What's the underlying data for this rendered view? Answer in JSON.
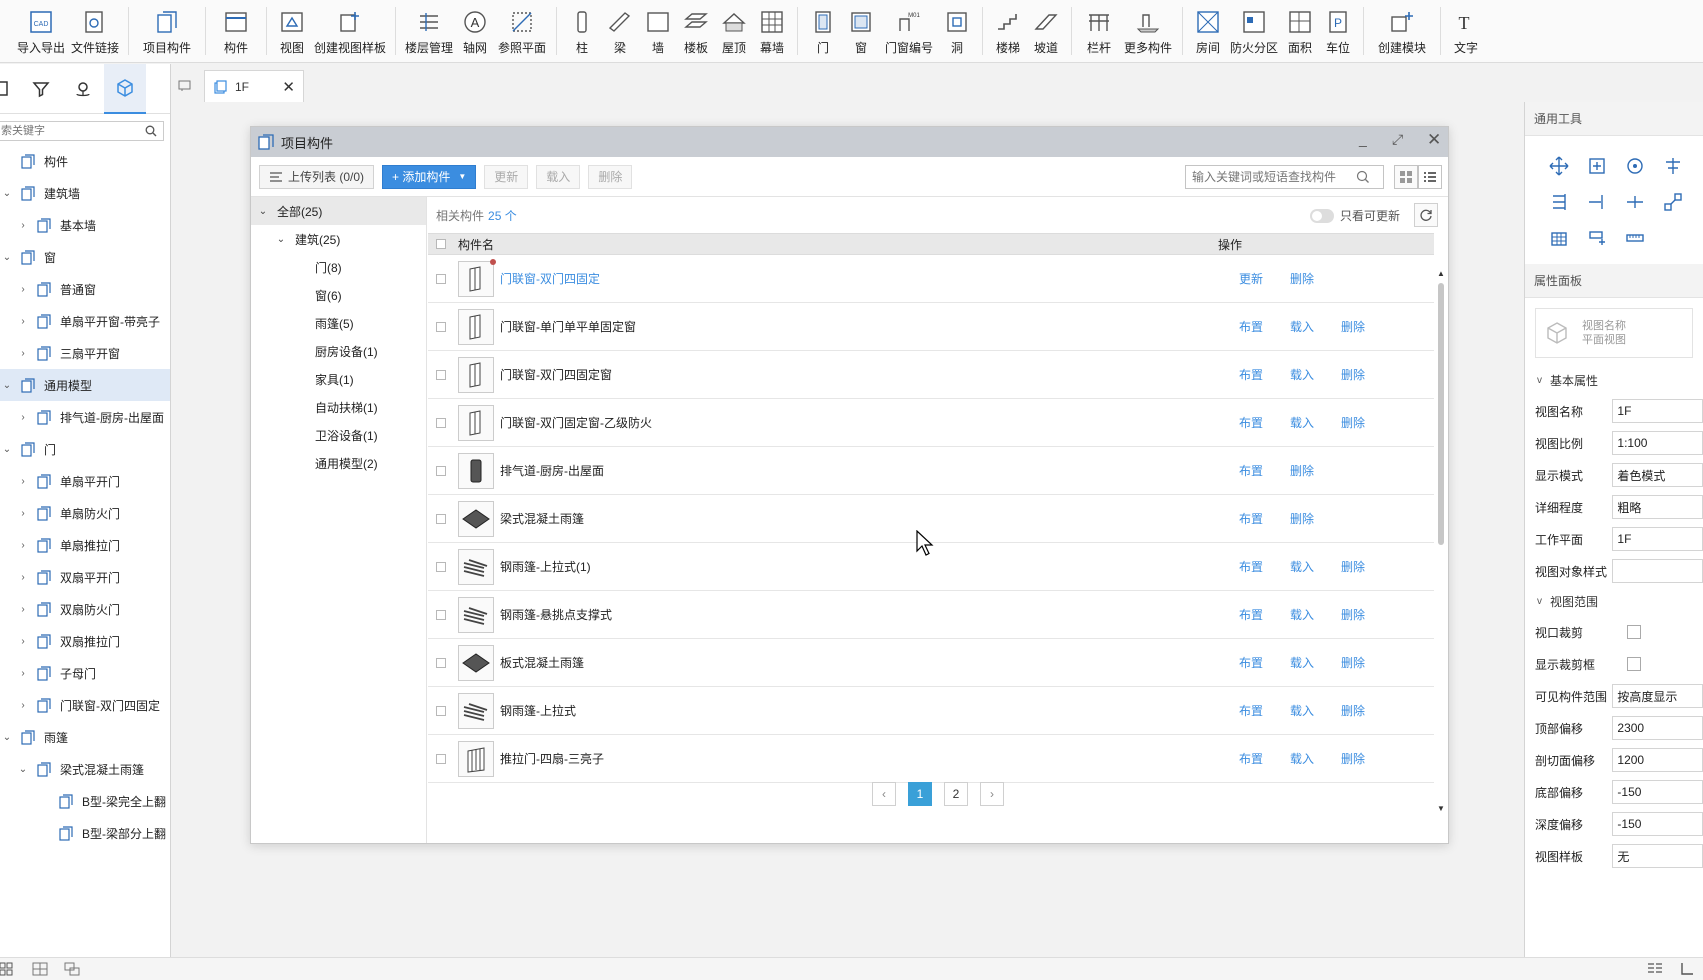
{
  "toolbar": {
    "items": [
      {
        "label": "导入导出",
        "icon": "cad-import-icon"
      },
      {
        "label": "文件链接",
        "icon": "file-link-icon"
      },
      {
        "label": "项目构件",
        "icon": "project-component-icon"
      },
      {
        "label": "构件",
        "icon": "component-icon"
      },
      {
        "label": "视图",
        "icon": "view-icon"
      },
      {
        "label": "创建视图样板",
        "icon": "view-template-icon"
      },
      {
        "label": "楼层管理",
        "icon": "floor-manage-icon"
      },
      {
        "label": "轴网",
        "icon": "axis-grid-icon"
      },
      {
        "label": "参照平面",
        "icon": "reference-plane-icon"
      },
      {
        "label": "柱",
        "icon": "column-icon"
      },
      {
        "label": "梁",
        "icon": "beam-icon"
      },
      {
        "label": "墙",
        "icon": "wall-icon"
      },
      {
        "label": "楼板",
        "icon": "slab-icon"
      },
      {
        "label": "屋顶",
        "icon": "roof-icon"
      },
      {
        "label": "幕墙",
        "icon": "curtain-wall-icon"
      },
      {
        "label": "门",
        "icon": "door-icon"
      },
      {
        "label": "窗",
        "icon": "window-icon"
      },
      {
        "label": "门窗编号",
        "icon": "door-window-number-icon"
      },
      {
        "label": "洞",
        "icon": "opening-icon"
      },
      {
        "label": "楼梯",
        "icon": "stair-icon"
      },
      {
        "label": "坡道",
        "icon": "ramp-icon"
      },
      {
        "label": "栏杆",
        "icon": "railing-icon"
      },
      {
        "label": "更多构件",
        "icon": "more-components-icon"
      },
      {
        "label": "房间",
        "icon": "room-icon"
      },
      {
        "label": "防火分区",
        "icon": "fire-zone-icon"
      },
      {
        "label": "面积",
        "icon": "area-icon"
      },
      {
        "label": "车位",
        "icon": "parking-icon"
      },
      {
        "label": "创建模块",
        "icon": "create-module-icon"
      },
      {
        "label": "文字",
        "icon": "text-icon"
      }
    ]
  },
  "left_panel": {
    "search_placeholder": "索关键字",
    "tree": [
      {
        "label": "构件",
        "level": 0,
        "toggle": ""
      },
      {
        "label": "建筑墙",
        "level": 1,
        "toggle": "v"
      },
      {
        "label": "基本墙",
        "level": 2,
        "toggle": ">"
      },
      {
        "label": "窗",
        "level": 1,
        "toggle": "v"
      },
      {
        "label": "普通窗",
        "level": 2,
        "toggle": ">"
      },
      {
        "label": "单扇平开窗-带亮子",
        "level": 2,
        "toggle": ">"
      },
      {
        "label": "三扇平开窗",
        "level": 2,
        "toggle": ">"
      },
      {
        "label": "通用模型",
        "level": 1,
        "toggle": "v",
        "selected": true
      },
      {
        "label": "排气道-厨房-出屋面",
        "level": 2,
        "toggle": ">"
      },
      {
        "label": "门",
        "level": 1,
        "toggle": "v"
      },
      {
        "label": "单扇平开门",
        "level": 2,
        "toggle": ">"
      },
      {
        "label": "单扇防火门",
        "level": 2,
        "toggle": ">"
      },
      {
        "label": "单扇推拉门",
        "level": 2,
        "toggle": ">"
      },
      {
        "label": "双扇平开门",
        "level": 2,
        "toggle": ">"
      },
      {
        "label": "双扇防火门",
        "level": 2,
        "toggle": ">"
      },
      {
        "label": "双扇推拉门",
        "level": 2,
        "toggle": ">"
      },
      {
        "label": "子母门",
        "level": 2,
        "toggle": ">"
      },
      {
        "label": "门联窗-双门四固定",
        "level": 2,
        "toggle": ">"
      },
      {
        "label": "雨篷",
        "level": 1,
        "toggle": "v"
      },
      {
        "label": "梁式混凝土雨篷",
        "level": 2,
        "toggle": "v"
      },
      {
        "label": "B型-梁完全上翻",
        "level": 3,
        "toggle": ""
      },
      {
        "label": "B型-梁部分上翻",
        "level": 3,
        "toggle": ""
      }
    ]
  },
  "view_tab": {
    "label": "1F"
  },
  "dialog": {
    "title": "项目构件",
    "upload_label": "上传列表 (0/0)",
    "add_label": "+ 添加构件",
    "update_label": "更新",
    "load_label": "载入",
    "delete_label": "删除",
    "search_placeholder": "输入关键词或短语查找构件",
    "summary_label": "相关构件",
    "summary_count": "25 个",
    "toggle_label": "只看可更新",
    "col_name": "构件名",
    "col_ops": "操作",
    "categories": [
      {
        "label": "全部(25)",
        "indent": 0,
        "chev": "v",
        "selected": true
      },
      {
        "label": "建筑(25)",
        "indent": 1,
        "chev": "v"
      },
      {
        "label": "门(8)",
        "indent": 2,
        "chev": ""
      },
      {
        "label": "窗(6)",
        "indent": 2,
        "chev": ""
      },
      {
        "label": "雨篷(5)",
        "indent": 2,
        "chev": ""
      },
      {
        "label": "厨房设备(1)",
        "indent": 2,
        "chev": ""
      },
      {
        "label": "家具(1)",
        "indent": 2,
        "chev": ""
      },
      {
        "label": "自动扶梯(1)",
        "indent": 2,
        "chev": ""
      },
      {
        "label": "卫浴设备(1)",
        "indent": 2,
        "chev": ""
      },
      {
        "label": "通用模型(2)",
        "indent": 2,
        "chev": ""
      }
    ],
    "rows": [
      {
        "name": "门联窗-双门四固定",
        "thumb": "door-window-icon",
        "link": true,
        "dot": true,
        "ops": [
          "更新",
          "删除"
        ]
      },
      {
        "name": "门联窗-单门单平单固定窗",
        "thumb": "door-window-icon",
        "ops": [
          "布置",
          "载入",
          "删除"
        ]
      },
      {
        "name": "门联窗-双门四固定窗",
        "thumb": "door-window-icon",
        "ops": [
          "布置",
          "载入",
          "删除"
        ]
      },
      {
        "name": "门联窗-双门固定窗-乙级防火",
        "thumb": "door-window-icon",
        "ops": [
          "布置",
          "载入",
          "删除"
        ]
      },
      {
        "name": "排气道-厨房-出屋面",
        "thumb": "exhaust-duct-icon",
        "ops": [
          "布置",
          "删除"
        ]
      },
      {
        "name": "梁式混凝土雨篷",
        "thumb": "concrete-canopy-icon",
        "ops": [
          "布置",
          "删除"
        ]
      },
      {
        "name": "钢雨篷-上拉式(1)",
        "thumb": "steel-canopy-icon",
        "ops": [
          "布置",
          "载入",
          "删除"
        ]
      },
      {
        "name": "钢雨篷-悬挑点支撑式",
        "thumb": "steel-canopy-icon",
        "ops": [
          "布置",
          "载入",
          "删除"
        ]
      },
      {
        "name": "板式混凝土雨篷",
        "thumb": "concrete-canopy-icon",
        "ops": [
          "布置",
          "载入",
          "删除"
        ]
      },
      {
        "name": "钢雨篷-上拉式",
        "thumb": "steel-canopy-icon",
        "ops": [
          "布置",
          "载入",
          "删除"
        ]
      },
      {
        "name": "推拉门-四扇-三亮子",
        "thumb": "sliding-door-icon",
        "ops": [
          "布置",
          "载入",
          "删除"
        ]
      }
    ],
    "pages": [
      "1",
      "2"
    ],
    "current_page": "1"
  },
  "right_panel": {
    "tools_title": "通用工具",
    "props_title": "属性面板",
    "header_name_label": "视图名称",
    "header_type_label": "平面视图",
    "basic_group": "基本属性",
    "range_group": "视图范围",
    "basic_props": [
      {
        "key": "视图名称",
        "value": "1F"
      },
      {
        "key": "视图比例",
        "value": "1:100"
      },
      {
        "key": "显示模式",
        "value": "着色模式"
      },
      {
        "key": "详细程度",
        "value": "粗略"
      },
      {
        "key": "工作平面",
        "value": "1F"
      },
      {
        "key": "视图对象样式",
        "value": ""
      }
    ],
    "range_props": [
      {
        "key": "视口裁剪",
        "type": "checkbox"
      },
      {
        "key": "显示裁剪框",
        "type": "checkbox"
      },
      {
        "key": "可见构件范围",
        "value": "按高度显示"
      },
      {
        "key": "顶部偏移",
        "value": "2300"
      },
      {
        "key": "剖切面偏移",
        "value": "1200"
      },
      {
        "key": "底部偏移",
        "value": "-150"
      },
      {
        "key": "深度偏移",
        "value": "-150"
      },
      {
        "key": "视图样板",
        "value": "无"
      }
    ]
  },
  "colors": {
    "accent": "#3b8de0",
    "title_bar": "#c9cdd3",
    "selected_row": "#dfe9f6"
  }
}
